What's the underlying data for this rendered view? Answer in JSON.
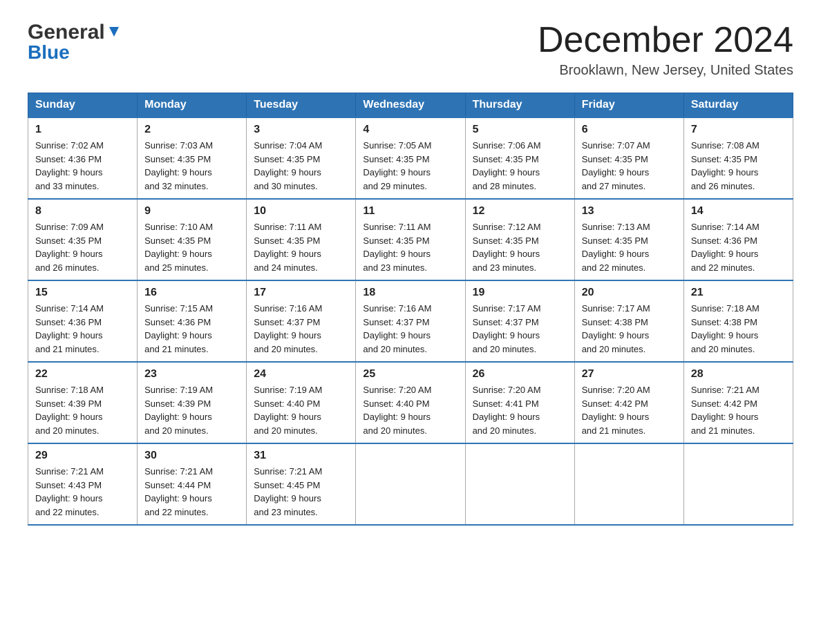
{
  "header": {
    "logo_general": "General",
    "logo_blue": "Blue",
    "month_title": "December 2024",
    "location": "Brooklawn, New Jersey, United States"
  },
  "weekdays": [
    "Sunday",
    "Monday",
    "Tuesday",
    "Wednesday",
    "Thursday",
    "Friday",
    "Saturday"
  ],
  "weeks": [
    [
      {
        "day": "1",
        "sunrise": "7:02 AM",
        "sunset": "4:36 PM",
        "daylight": "9 hours and 33 minutes."
      },
      {
        "day": "2",
        "sunrise": "7:03 AM",
        "sunset": "4:35 PM",
        "daylight": "9 hours and 32 minutes."
      },
      {
        "day": "3",
        "sunrise": "7:04 AM",
        "sunset": "4:35 PM",
        "daylight": "9 hours and 30 minutes."
      },
      {
        "day": "4",
        "sunrise": "7:05 AM",
        "sunset": "4:35 PM",
        "daylight": "9 hours and 29 minutes."
      },
      {
        "day": "5",
        "sunrise": "7:06 AM",
        "sunset": "4:35 PM",
        "daylight": "9 hours and 28 minutes."
      },
      {
        "day": "6",
        "sunrise": "7:07 AM",
        "sunset": "4:35 PM",
        "daylight": "9 hours and 27 minutes."
      },
      {
        "day": "7",
        "sunrise": "7:08 AM",
        "sunset": "4:35 PM",
        "daylight": "9 hours and 26 minutes."
      }
    ],
    [
      {
        "day": "8",
        "sunrise": "7:09 AM",
        "sunset": "4:35 PM",
        "daylight": "9 hours and 26 minutes."
      },
      {
        "day": "9",
        "sunrise": "7:10 AM",
        "sunset": "4:35 PM",
        "daylight": "9 hours and 25 minutes."
      },
      {
        "day": "10",
        "sunrise": "7:11 AM",
        "sunset": "4:35 PM",
        "daylight": "9 hours and 24 minutes."
      },
      {
        "day": "11",
        "sunrise": "7:11 AM",
        "sunset": "4:35 PM",
        "daylight": "9 hours and 23 minutes."
      },
      {
        "day": "12",
        "sunrise": "7:12 AM",
        "sunset": "4:35 PM",
        "daylight": "9 hours and 23 minutes."
      },
      {
        "day": "13",
        "sunrise": "7:13 AM",
        "sunset": "4:35 PM",
        "daylight": "9 hours and 22 minutes."
      },
      {
        "day": "14",
        "sunrise": "7:14 AM",
        "sunset": "4:36 PM",
        "daylight": "9 hours and 22 minutes."
      }
    ],
    [
      {
        "day": "15",
        "sunrise": "7:14 AM",
        "sunset": "4:36 PM",
        "daylight": "9 hours and 21 minutes."
      },
      {
        "day": "16",
        "sunrise": "7:15 AM",
        "sunset": "4:36 PM",
        "daylight": "9 hours and 21 minutes."
      },
      {
        "day": "17",
        "sunrise": "7:16 AM",
        "sunset": "4:37 PM",
        "daylight": "9 hours and 20 minutes."
      },
      {
        "day": "18",
        "sunrise": "7:16 AM",
        "sunset": "4:37 PM",
        "daylight": "9 hours and 20 minutes."
      },
      {
        "day": "19",
        "sunrise": "7:17 AM",
        "sunset": "4:37 PM",
        "daylight": "9 hours and 20 minutes."
      },
      {
        "day": "20",
        "sunrise": "7:17 AM",
        "sunset": "4:38 PM",
        "daylight": "9 hours and 20 minutes."
      },
      {
        "day": "21",
        "sunrise": "7:18 AM",
        "sunset": "4:38 PM",
        "daylight": "9 hours and 20 minutes."
      }
    ],
    [
      {
        "day": "22",
        "sunrise": "7:18 AM",
        "sunset": "4:39 PM",
        "daylight": "9 hours and 20 minutes."
      },
      {
        "day": "23",
        "sunrise": "7:19 AM",
        "sunset": "4:39 PM",
        "daylight": "9 hours and 20 minutes."
      },
      {
        "day": "24",
        "sunrise": "7:19 AM",
        "sunset": "4:40 PM",
        "daylight": "9 hours and 20 minutes."
      },
      {
        "day": "25",
        "sunrise": "7:20 AM",
        "sunset": "4:40 PM",
        "daylight": "9 hours and 20 minutes."
      },
      {
        "day": "26",
        "sunrise": "7:20 AM",
        "sunset": "4:41 PM",
        "daylight": "9 hours and 20 minutes."
      },
      {
        "day": "27",
        "sunrise": "7:20 AM",
        "sunset": "4:42 PM",
        "daylight": "9 hours and 21 minutes."
      },
      {
        "day": "28",
        "sunrise": "7:21 AM",
        "sunset": "4:42 PM",
        "daylight": "9 hours and 21 minutes."
      }
    ],
    [
      {
        "day": "29",
        "sunrise": "7:21 AM",
        "sunset": "4:43 PM",
        "daylight": "9 hours and 22 minutes."
      },
      {
        "day": "30",
        "sunrise": "7:21 AM",
        "sunset": "4:44 PM",
        "daylight": "9 hours and 22 minutes."
      },
      {
        "day": "31",
        "sunrise": "7:21 AM",
        "sunset": "4:45 PM",
        "daylight": "9 hours and 23 minutes."
      },
      null,
      null,
      null,
      null
    ]
  ],
  "labels": {
    "sunrise": "Sunrise:",
    "sunset": "Sunset:",
    "daylight": "Daylight:"
  }
}
